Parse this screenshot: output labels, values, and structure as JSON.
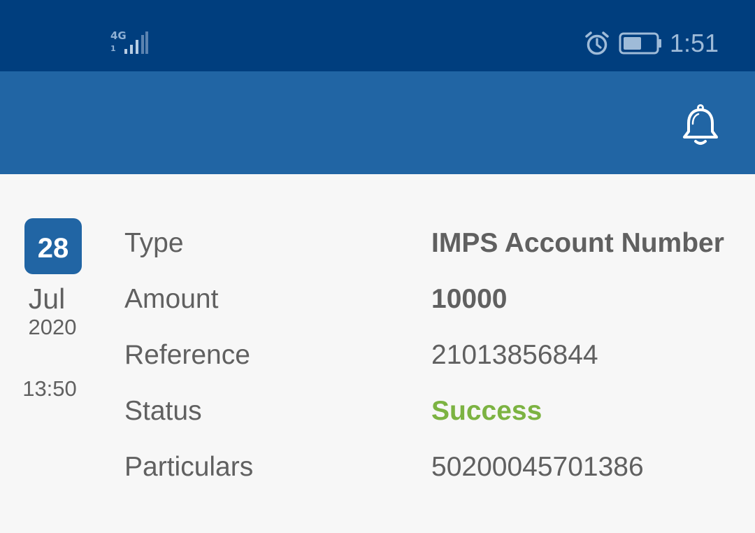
{
  "status_bar": {
    "network_type": "4G",
    "sim_slot": "1",
    "time": "1:51"
  },
  "transaction": {
    "day": "28",
    "month": "Jul",
    "year": "2020",
    "time": "13:50",
    "rows": [
      {
        "label": "Type",
        "value": "IMPS Account Number"
      },
      {
        "label": "Amount",
        "value": "10000"
      },
      {
        "label": "Reference",
        "value": "21013856844"
      },
      {
        "label": "Status",
        "value": "Success"
      },
      {
        "label": "Particulars",
        "value": "50200045701386"
      }
    ]
  },
  "colors": {
    "status_bar": "#003e7e",
    "app_bar": "#2165a4",
    "success": "#7cb342",
    "text": "#606060"
  },
  "icons": [
    "signal-icon",
    "alarm-icon",
    "battery-icon",
    "bell-icon"
  ]
}
